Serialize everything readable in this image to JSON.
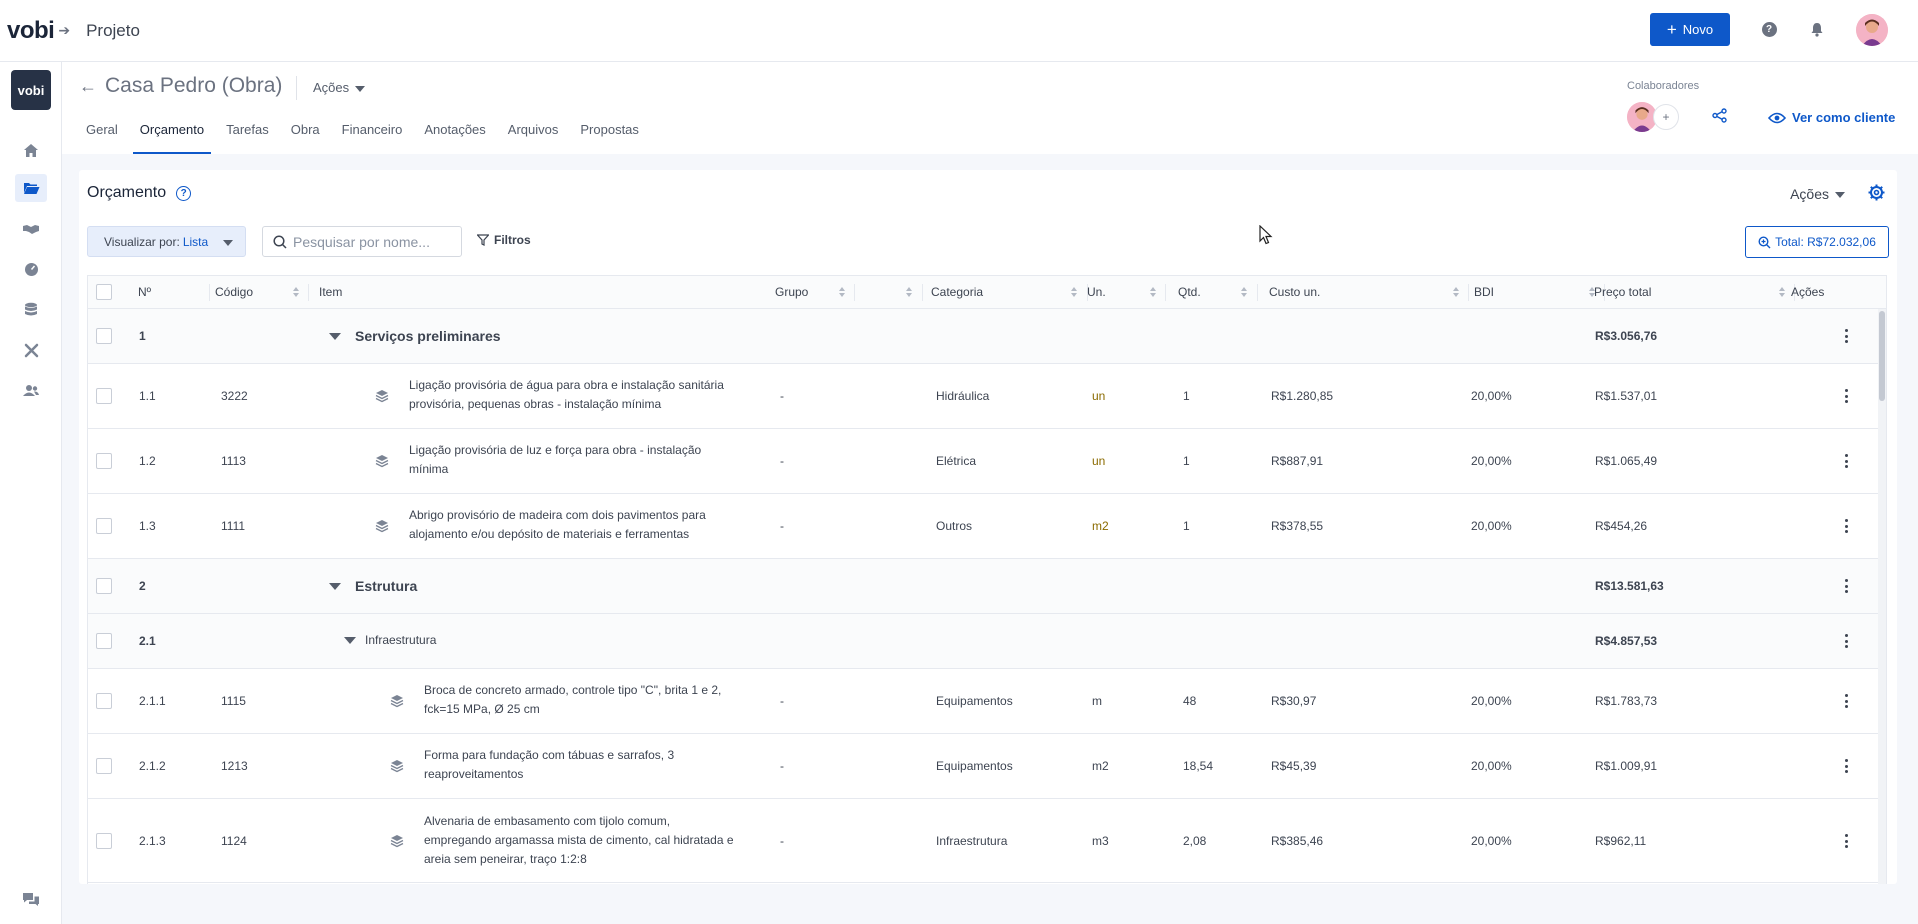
{
  "topbar": {
    "logo": "vobi",
    "title": "Projeto",
    "new_button": "Novo"
  },
  "sidebar": {
    "logo": "vobi",
    "items": [
      "home-icon",
      "folder-icon",
      "handshake-icon",
      "gauge-icon",
      "database-icon",
      "tools-icon",
      "users-icon"
    ]
  },
  "project": {
    "title": "Casa Pedro (Obra)",
    "actions_label": "Ações",
    "tabs": [
      "Geral",
      "Orçamento",
      "Tarefas",
      "Obra",
      "Financeiro",
      "Anotações",
      "Arquivos",
      "Propostas"
    ],
    "active_tab": "Orçamento",
    "collaborators_label": "Colaboradores",
    "add_collaborator": "+",
    "view_as_client": "Ver como cliente"
  },
  "budget": {
    "title": "Orçamento",
    "actions_label": "Ações",
    "view_by_label": "Visualizar por:",
    "view_by_value": "Lista",
    "search_placeholder": "Pesquisar por nome...",
    "filters_label": "Filtros",
    "total_label": "Total: R$72.032,06"
  },
  "table": {
    "columns": [
      "Nº",
      "Código",
      "Item",
      "Grupo",
      "Categoria",
      "Un.",
      "Qtd.",
      "Custo un.",
      "BDI",
      "Preço total",
      "Ações"
    ],
    "rows": [
      {
        "type": "group",
        "num": "1",
        "title": "Serviços preliminares",
        "total": "R$3.056,76"
      },
      {
        "type": "item",
        "num": "1.1",
        "code": "3222",
        "line1": "Ligação provisória de água para obra e instalação sanitária",
        "line2": "provisória, pequenas obras - instalação mínima",
        "group": "-",
        "category": "Hidráulica",
        "unit": "un",
        "qty": "1",
        "unit_cost": "R$1.280,85",
        "bdi": "20,00%",
        "total": "R$1.537,01"
      },
      {
        "type": "item",
        "num": "1.2",
        "code": "1113",
        "line1": "Ligação provisória de luz e força para obra - instalação",
        "line2": "mínima",
        "group": "-",
        "category": "Elétrica",
        "unit": "un",
        "qty": "1",
        "unit_cost": "R$887,91",
        "bdi": "20,00%",
        "total": "R$1.065,49"
      },
      {
        "type": "item",
        "num": "1.3",
        "code": "1111",
        "line1": "Abrigo provisório de madeira com dois pavimentos para",
        "line2": "alojamento e/ou depósito de materiais e ferramentas",
        "group": "-",
        "category": "Outros",
        "unit": "m2",
        "qty": "1",
        "unit_cost": "R$378,55",
        "bdi": "20,00%",
        "total": "R$454,26"
      },
      {
        "type": "group",
        "num": "2",
        "title": "Estrutura",
        "total": "R$13.581,63"
      },
      {
        "type": "subgroup",
        "num": "2.1",
        "title": "Infraestrutura",
        "total": "R$4.857,53"
      },
      {
        "type": "item",
        "num": "2.1.1",
        "code": "1115",
        "line1": "Broca de concreto armado, controle tipo \"C\", brita 1 e 2,",
        "line2": "fck=15 MPa, Ø 25 cm",
        "group": "-",
        "category": "Equipamentos",
        "unit": "m",
        "qty": "48",
        "unit_cost": "R$30,97",
        "bdi": "20,00%",
        "total": "R$1.783,73"
      },
      {
        "type": "item",
        "num": "2.1.2",
        "code": "1213",
        "line1": "Forma para fundação com tábuas e sarrafos, 3",
        "line2": "reaproveitamentos",
        "group": "-",
        "category": "Equipamentos",
        "unit": "m2",
        "qty": "18,54",
        "unit_cost": "R$45,39",
        "bdi": "20,00%",
        "total": "R$1.009,91"
      },
      {
        "type": "item",
        "num": "2.1.3",
        "code": "1124",
        "line1": "Alvenaria de embasamento com tijolo comum,",
        "line2": "empregando argamassa mista de cimento, cal hidratada e",
        "line3": "areia sem peneirar, traço 1:2:8",
        "group": "-",
        "category": "Infraestrutura",
        "unit": "m3",
        "qty": "2,08",
        "unit_cost": "R$385,46",
        "bdi": "20,00%",
        "total": "R$962,11"
      }
    ]
  }
}
